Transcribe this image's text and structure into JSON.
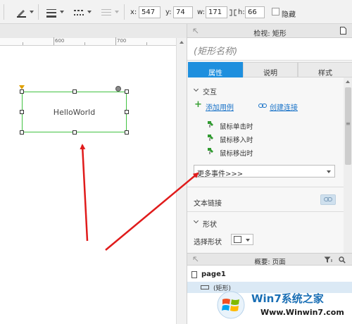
{
  "toolbar": {
    "x_label": "x:",
    "x_value": "547",
    "y_label": "y:",
    "y_value": "74",
    "w_label": "w:",
    "w_value": "171",
    "h_label": "h:",
    "h_value": "66",
    "hide_label": "隐藏"
  },
  "ruler": {
    "ticks": [
      "600",
      "700"
    ]
  },
  "canvas": {
    "shape_text": "HelloWorld"
  },
  "panel": {
    "title": "检视: 矩形",
    "shape_name_placeholder": "(矩形名称)",
    "tabs": [
      {
        "label": "属性",
        "active": true
      },
      {
        "label": "说明",
        "active": false
      },
      {
        "label": "样式",
        "active": false
      }
    ],
    "interaction": {
      "section_label": "交互",
      "add_case": "添加用例",
      "create_link": "创建连接",
      "events": [
        "鼠标单击时",
        "鼠标移入时",
        "鼠标移出时"
      ],
      "more_events": "更多事件>>>"
    },
    "text_link_label": "文本链接",
    "shape_section_label": "形状",
    "select_shape_label": "选择形状"
  },
  "outline": {
    "title": "概要: 页面",
    "page_name": "page1",
    "item_label": "(矩形)"
  },
  "watermark": {
    "title": "Win7系统之家",
    "url": "Www.Winwin7.com"
  },
  "colors": {
    "accent": "#1e8fde",
    "selection_border": "#42c242",
    "arrow": "#e01b1b",
    "link": "#1a73c8"
  }
}
